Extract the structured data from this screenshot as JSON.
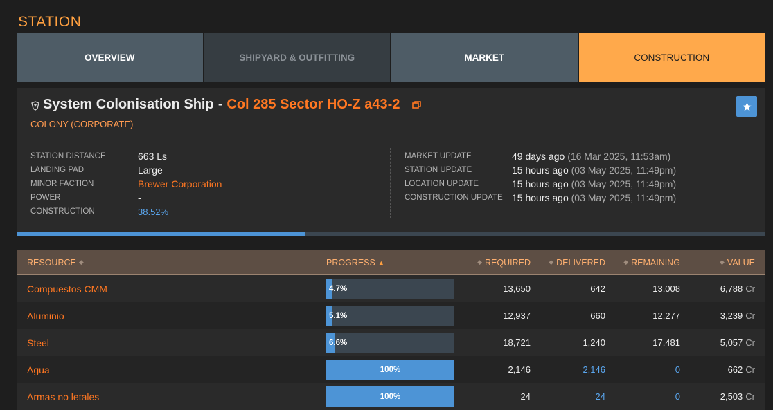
{
  "page_title": "STATION",
  "tabs": [
    {
      "label": "OVERVIEW",
      "state": "normal"
    },
    {
      "label": "SHIPYARD & OUTFITTING",
      "state": "disabled"
    },
    {
      "label": "MARKET",
      "state": "normal"
    },
    {
      "label": "CONSTRUCTION",
      "state": "active"
    }
  ],
  "station": {
    "name": "System Colonisation Ship",
    "dash": "-",
    "system": "Col 285 Sector HO-Z a43-2",
    "type": "COLONY (CORPORATE)",
    "left_info": [
      {
        "label": "STATION DISTANCE",
        "value": "663 Ls"
      },
      {
        "label": "LANDING PAD",
        "value": "Large"
      },
      {
        "label": "MINOR FACTION",
        "value": "Brewer Corporation"
      },
      {
        "label": "POWER",
        "value": "-"
      },
      {
        "label": "CONSTRUCTION",
        "value": "38.52%"
      }
    ],
    "right_info": [
      {
        "label": "MARKET UPDATE",
        "value": "49 days ago",
        "detail": "(16 Mar 2025, 11:53am)"
      },
      {
        "label": "STATION UPDATE",
        "value": "15 hours ago",
        "detail": "(03 May 2025, 11:49pm)"
      },
      {
        "label": "LOCATION UPDATE",
        "value": "15 hours ago",
        "detail": "(03 May 2025, 11:49pm)"
      },
      {
        "label": "CONSTRUCTION UPDATE",
        "value": "15 hours ago",
        "detail": "(03 May 2025, 11:49pm)"
      }
    ],
    "construction_progress": 0.3852
  },
  "table": {
    "headers": {
      "resource": "RESOURCE",
      "progress": "PROGRESS",
      "required": "REQUIRED",
      "delivered": "DELIVERED",
      "remaining": "REMAINING",
      "value": "VALUE"
    },
    "rows": [
      {
        "resource": "Compuestos CMM",
        "progress": 0.047,
        "progress_label": "4.7%",
        "required": "13,650",
        "delivered": "642",
        "remaining": "13,008",
        "value": "6,788",
        "unit": "Cr"
      },
      {
        "resource": "Aluminio",
        "progress": 0.051,
        "progress_label": "5.1%",
        "required": "12,937",
        "delivered": "660",
        "remaining": "12,277",
        "value": "3,239",
        "unit": "Cr"
      },
      {
        "resource": "Steel",
        "progress": 0.066,
        "progress_label": "6.6%",
        "required": "18,721",
        "delivered": "1,240",
        "remaining": "17,481",
        "value": "5,057",
        "unit": "Cr"
      },
      {
        "resource": "Agua",
        "progress": 1.0,
        "progress_label": "100%",
        "required": "2,146",
        "delivered": "2,146",
        "remaining": "0",
        "value": "662",
        "unit": "Cr"
      },
      {
        "resource": "Armas no letales",
        "progress": 1.0,
        "progress_label": "100%",
        "required": "24",
        "delivered": "24",
        "remaining": "0",
        "value": "2,503",
        "unit": "Cr"
      }
    ]
  },
  "icons": {
    "ship": "ship-icon",
    "copy": "copy-icon",
    "favorite": "star-icon",
    "sort": "sort-icon",
    "sort_asc": "sort-asc-icon"
  },
  "colors": {
    "accent_orange": "#ff7722",
    "active_tab": "#ffa94b",
    "progress_blue": "#4d94d6",
    "link_blue": "#5aa6ee"
  }
}
